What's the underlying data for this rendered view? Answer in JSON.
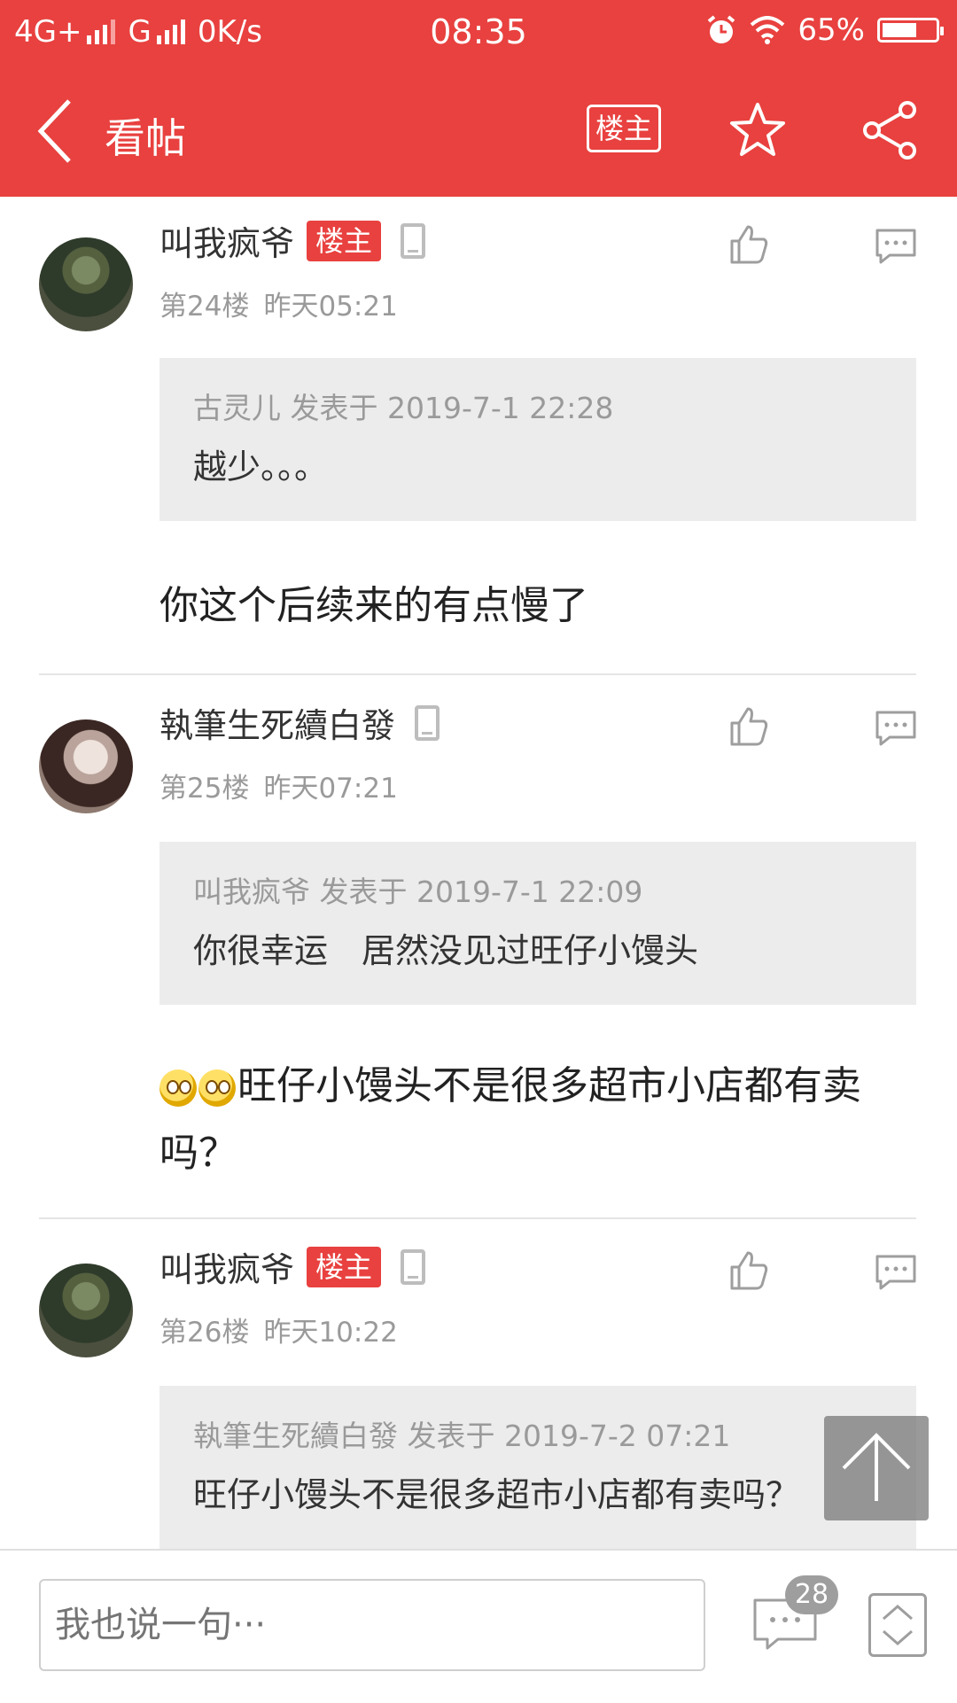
{
  "status_bar": {
    "network1": "4G+",
    "network2": "G",
    "speed": "0K/s",
    "time": "08:35",
    "battery": "65%",
    "battery_level": 0.65
  },
  "navbar": {
    "title": "看帖",
    "owner_label": "楼主"
  },
  "posts": [
    {
      "username": "叫我疯爷",
      "badge": "楼主",
      "floor": "第24楼",
      "time": "昨天05:21",
      "quote_meta": "古灵儿 发表于 2019-7-1 22:28",
      "quote_text": "越少。。。",
      "content": "你这个后续来的有点慢了"
    },
    {
      "username": "執筆生死續白發",
      "floor": "第25楼",
      "time": "昨天07:21",
      "quote_meta": "叫我疯爷 发表于 2019-7-1 22:09",
      "quote_text": "你很幸运　居然没见过旺仔小馒头",
      "content": "旺仔小馒头不是很多超市小店都有卖吗？"
    },
    {
      "username": "叫我疯爷",
      "badge": "楼主",
      "floor": "第26楼",
      "time": "昨天10:22",
      "quote_meta": "執筆生死續白發 发表于 2019-7-2 07:21",
      "quote_text": "旺仔小馒头不是很多超市小店都有卖吗？"
    }
  ],
  "bottom_bar": {
    "input_placeholder": "我也说一句···",
    "comment_count": "28"
  },
  "colors": {
    "brand_red": "#e8413f",
    "quote_bg": "#ececec"
  }
}
